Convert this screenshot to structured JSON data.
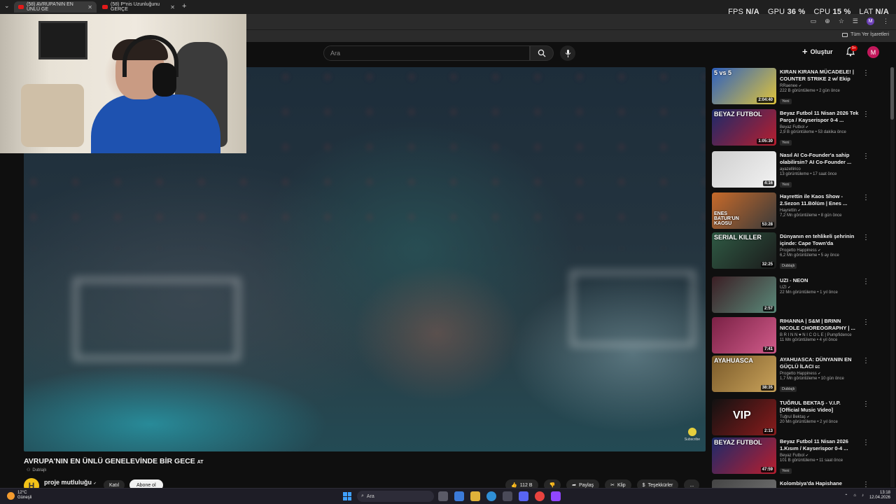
{
  "browser": {
    "tabs": [
      {
        "label": "(58) AVRUPA'NIN EN ÜNLÜ GE",
        "active": true
      },
      {
        "label": "(58) P*nis Uzunluğunu GERÇE",
        "active": false
      }
    ],
    "new_tab": "+",
    "menu": "⌄",
    "bookmarks_label": "Tüm Yer İşaretleri"
  },
  "perf": {
    "fps_label": "FPS",
    "fps_value": "N/A",
    "gpu_label": "GPU",
    "gpu_value": "36 %",
    "cpu_label": "CPU",
    "cpu_value": "15 %",
    "lat_label": "LAT",
    "lat_value": "N/A"
  },
  "youtube": {
    "search_placeholder": "Ara",
    "create_label": "Oluştur",
    "notif_badge": "9+",
    "avatar_letter": "M"
  },
  "video": {
    "title": "AVRUPA'NIN EN ÜNLÜ GENELEVİNDE BİR GECE",
    "title_suffix": "AT",
    "dubbed": "Dublajlı",
    "channel": "proje mutluluğu",
    "channel_initial": "H",
    "join": "Katıl",
    "subscribe": "Abone ol",
    "likes": "112 B",
    "share": "Paylaş",
    "clip": "Klip",
    "thanks": "Teşekkürler",
    "more": "...",
    "watermark": "Subscribe"
  },
  "recommendations": [
    {
      "title": "KIRAN KIRANA MÜCADELE! | COUNTER STRIKE 2 w/ Ekip",
      "channel": "RRaenee",
      "meta": "222 B görüntüleme • 2 gün önce",
      "badge": "Yeni",
      "duration": "2:04:40",
      "thumb_text": "5 vs 5",
      "color1": "#2c5fbf",
      "color2": "#e0c43a"
    },
    {
      "title": "Beyaz Futbol 11 Nisan 2026 Tek Parça / Kayserispor 0-4 ...",
      "channel": "Beyaz Futbol",
      "meta": "2,9 B görüntüleme • 53 dakika önce",
      "badge": "Yeni",
      "duration": "1:05:30",
      "thumb_text": "BEYAZ FUTBOL",
      "color1": "#1b2a6b",
      "color2": "#b81e2e"
    },
    {
      "title": "Nasıl AI Co-Founder'a sahip olabilirsin? AI Co-Founder ...",
      "channel": "ayazellirico",
      "meta": "13 görüntüleme • 17 saat önce",
      "badge": "Yeni",
      "duration": "4:16",
      "thumb_text": "",
      "color1": "#cfcfcf",
      "color2": "#f2f2f2"
    },
    {
      "title": "Hayrettin ile Kaos Show - 2.Sezon 11.Bölüm | Enes ...",
      "channel": "Hayrettin",
      "meta": "7,2 Mn görüntüleme • 8 gün önce",
      "badge": "",
      "duration": "53:28",
      "thumb_text": "ENES BATUR'UN KAOSU",
      "color1": "#c76a2a",
      "color2": "#3a3a3a"
    },
    {
      "title": "Dünyanın en tehlikeli şehrinin içinde: Cape Town'da yaşamak...",
      "channel": "Progetto Happiness",
      "meta": "6,2 Mn görüntüleme • 5 ay önce",
      "badge": "Dublajlı",
      "duration": "32:25",
      "thumb_text": "SERIAL KILLER",
      "color1": "#2f5a44",
      "color2": "#1b1b1b"
    },
    {
      "title": "UZI - NEON",
      "channel": "UZI",
      "meta": "22 Mn görüntüleme • 1 yıl önce",
      "badge": "",
      "duration": "2:57",
      "thumb_text": "",
      "color1": "#3b1e24",
      "color2": "#5a8a7a"
    },
    {
      "title": "RIHANNA | S&M | BRINN NICOLE CHOREOGRAPHY | ...",
      "channel": "B R I N N ♥ N I C O L E | Pumpfidence",
      "meta": "11 Mn görüntüleme • 4 yıl önce",
      "badge": "",
      "duration": "7:41",
      "thumb_text": "",
      "color1": "#7a2145",
      "color2": "#d15b8a"
    },
    {
      "title": "AYAHUASCA: DÜNYANIN EN GÜÇLÜ İLACI",
      "title_tag": "EC",
      "channel": "Progetto Happiness",
      "meta": "1,7 Mn görüntüleme • 10 gün önce",
      "badge": "Dublajlı",
      "duration": "38:35",
      "thumb_text": "AYAHUASCA",
      "color1": "#7a5a2a",
      "color2": "#c9a25a"
    },
    {
      "title": "TUĞRUL BEKTAŞ - V.I.P. [Official Music Video]",
      "channel": "Tuğrul Bektaş",
      "meta": "20 Mn görüntüleme • 2 yıl önce",
      "badge": "",
      "duration": "2:13",
      "thumb_text": "VIP",
      "color1": "#111111",
      "color2": "#8a1c1c"
    },
    {
      "title": "Beyaz Futbol 11 Nisan 2026 1.Kısım / Kayserispor 0-4 ...",
      "channel": "Beyaz Futbol",
      "meta": "101 B görüntüleme • 11 saat önce",
      "badge": "Yeni",
      "duration": "47:59",
      "thumb_text": "BEYAZ FUTBOL",
      "color1": "#1b2a6b",
      "color2": "#b81e2e"
    },
    {
      "title": "Kolombiya'da Hapishane",
      "channel": "",
      "meta": "",
      "badge": "",
      "duration": "",
      "thumb_text": "",
      "color1": "#444444",
      "color2": "#777777"
    }
  ],
  "taskbar": {
    "weather_temp": "12°C",
    "weather_desc": "Güneşli",
    "search": "Ara",
    "time": "13:18",
    "date": "12.04.2026"
  }
}
